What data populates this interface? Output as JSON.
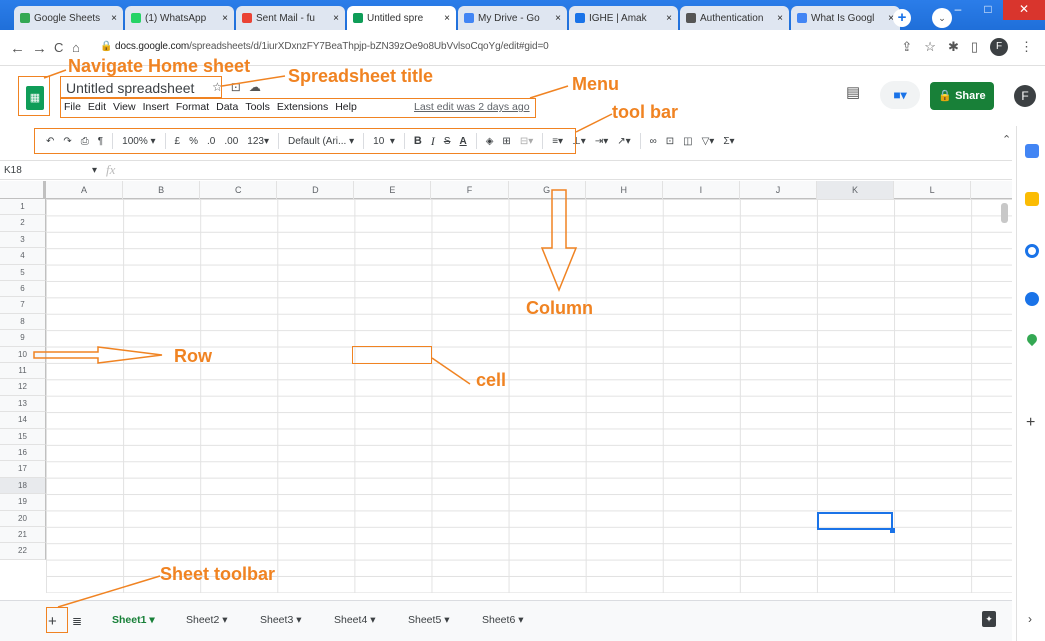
{
  "browser": {
    "tabs": [
      {
        "label": "Google Sheets",
        "active": false,
        "color": "#34a853"
      },
      {
        "label": "(1) WhatsApp",
        "active": false,
        "color": "#25d366"
      },
      {
        "label": "Sent Mail - fu",
        "active": false,
        "color": "#ea4335"
      },
      {
        "label": "Untitled spre",
        "active": true,
        "color": "#0f9d58"
      },
      {
        "label": "My Drive - Go",
        "active": false,
        "color": "#4285f4"
      },
      {
        "label": "IGHE | Amak",
        "active": false,
        "color": "#1a73e8"
      },
      {
        "label": "Authentication",
        "active": false,
        "color": "#555555"
      },
      {
        "label": "What Is Googl",
        "active": false,
        "color": "#4285f4"
      }
    ],
    "close_glyph": "×",
    "url_host": "docs.google.com",
    "url_path": "/spreadsheets/d/1iurXDxnzFY7BeaThpjp-bZN39zOe9o8UbVvlsoCqoYg/edit#gid=0",
    "profile_initial": "F"
  },
  "header": {
    "title": "Untitled spreadsheet",
    "menu": [
      "File",
      "Edit",
      "View",
      "Insert",
      "Format",
      "Data",
      "Tools",
      "Extensions",
      "Help"
    ],
    "last_edit": "Last edit was 2 days ago",
    "share_label": "Share",
    "avatar_initial": "F"
  },
  "toolbar": {
    "zoom": "100%",
    "currency": "£",
    "percent": "%",
    "dec_decrease": ".0",
    "dec_increase": ".00",
    "more_formats": "123",
    "font": "Default (Ari...",
    "font_size": "10",
    "bold": "B",
    "italic": "I",
    "strike": "S",
    "text_color": "A"
  },
  "formula_bar": {
    "cell_ref": "K18",
    "fx": "fx"
  },
  "grid": {
    "columns": [
      "A",
      "B",
      "C",
      "D",
      "E",
      "F",
      "G",
      "H",
      "I",
      "J",
      "K",
      "L"
    ],
    "rows": [
      "1",
      "2",
      "3",
      "4",
      "5",
      "6",
      "7",
      "8",
      "9",
      "10",
      "11",
      "12",
      "13",
      "14",
      "15",
      "16",
      "17",
      "18",
      "19",
      "20",
      "21",
      "22"
    ],
    "selected_column": "K",
    "selected_row": "18"
  },
  "sheets": {
    "add_glyph": "+",
    "tabs": [
      "Sheet1",
      "Sheet2",
      "Sheet3",
      "Sheet4",
      "Sheet5",
      "Sheet6"
    ],
    "active": "Sheet1",
    "caret": "▾"
  },
  "annotations": {
    "home": "Navigate Home sheet",
    "title": "Spreadsheet title",
    "menu": "Menu",
    "toolbar": "tool bar",
    "column": "Column",
    "row": "Row",
    "cell": "cell",
    "sheet_toolbar": "Sheet toolbar",
    "color": "#f08322"
  }
}
